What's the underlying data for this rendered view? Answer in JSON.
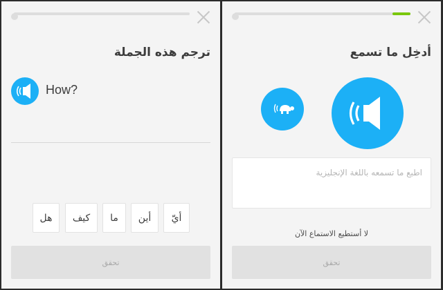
{
  "colors": {
    "accent_blue": "#1cb0f6",
    "progress_green": "#7ac70c",
    "button_disabled": "#e1e1e1",
    "background": "#f4f4f4"
  },
  "left_screen": {
    "progress": 0,
    "title": "ترجم هذه الجملة",
    "prompt_word": "How?",
    "word_bank": [
      "أيّ",
      "أين",
      "ما",
      "كيف",
      "هل"
    ],
    "check_button": "تحقق",
    "icons": {
      "speaker": "speaker-icon",
      "close": "close-icon"
    }
  },
  "right_screen": {
    "progress": 0.1,
    "title": "أدخِل ما تسمع",
    "answer_placeholder": "اطبع ما تسمعه باللغة الإنجليزية",
    "cant_listen": "لا أستطيع الاستماع الآن",
    "check_button": "تحقق",
    "icons": {
      "speaker": "speaker-icon",
      "slow": "turtle-icon",
      "close": "close-icon"
    }
  }
}
